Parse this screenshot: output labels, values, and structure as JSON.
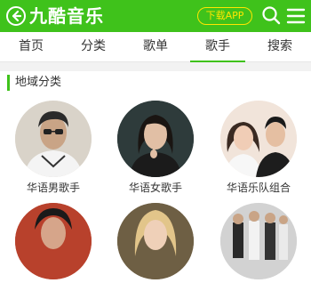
{
  "header": {
    "logo": "九酷音乐",
    "download_label": "下载APP",
    "back_icon": "back-arrow-circle-icon",
    "search_icon": "search-icon",
    "menu_icon": "menu-icon",
    "bg_color": "#3fc21b",
    "download_color": "#ffe600"
  },
  "tabs": [
    {
      "label": "首页"
    },
    {
      "label": "分类"
    },
    {
      "label": "歌单"
    },
    {
      "label": "歌手",
      "active": true
    },
    {
      "label": "搜索"
    }
  ],
  "section": {
    "title": "地域分类"
  },
  "categories": [
    {
      "label": "华语男歌手"
    },
    {
      "label": "华语女歌手"
    },
    {
      "label": "华语乐队组合"
    },
    {
      "label": ""
    },
    {
      "label": ""
    },
    {
      "label": ""
    }
  ]
}
